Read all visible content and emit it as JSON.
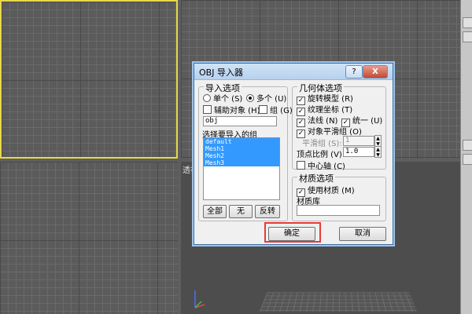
{
  "viewports": {
    "bottom_left_label": "透视"
  },
  "dialog": {
    "title": "OBJ 导入器",
    "help_label": "?",
    "close_label": "X",
    "import_options": {
      "legend": "导入选项",
      "single_label": "单个 (S)",
      "multiple_label": "多个 (U)",
      "helper_label": "辅助对象 (H)",
      "group_label": "组 (G)",
      "search_value": "obj",
      "select_groups_label": "选择要导入的组",
      "groups": [
        "default",
        "Mesh1",
        "Mesh2",
        "Mesh3"
      ],
      "all_button": "全部",
      "none_button": "无",
      "invert_button": "反转"
    },
    "geometry_options": {
      "legend": "几何体选项",
      "rotate_model": "旋转模型 (R)",
      "texture_coords": "纹理坐标 (T)",
      "normals": "法线 (N)",
      "unify": "统一 (U)",
      "object_smooth": "对象平滑组 (O)",
      "smooth_groups_label": "平滑组 (S):",
      "smooth_groups_value": "1",
      "vertex_scale_label": "顶点比例 (V):",
      "vertex_scale_value": "1.0",
      "center_pivot": "中心轴 (C)"
    },
    "material_options": {
      "legend": "材质选项",
      "use_materials": "使用材质 (M)",
      "library_label": "材质库",
      "library_value": ""
    },
    "ok_button": "确定",
    "cancel_button": "取消"
  },
  "colors": {
    "active_viewport_border": "#e8d84a",
    "selection": "#3399ff",
    "highlight": "#e53b3b"
  }
}
